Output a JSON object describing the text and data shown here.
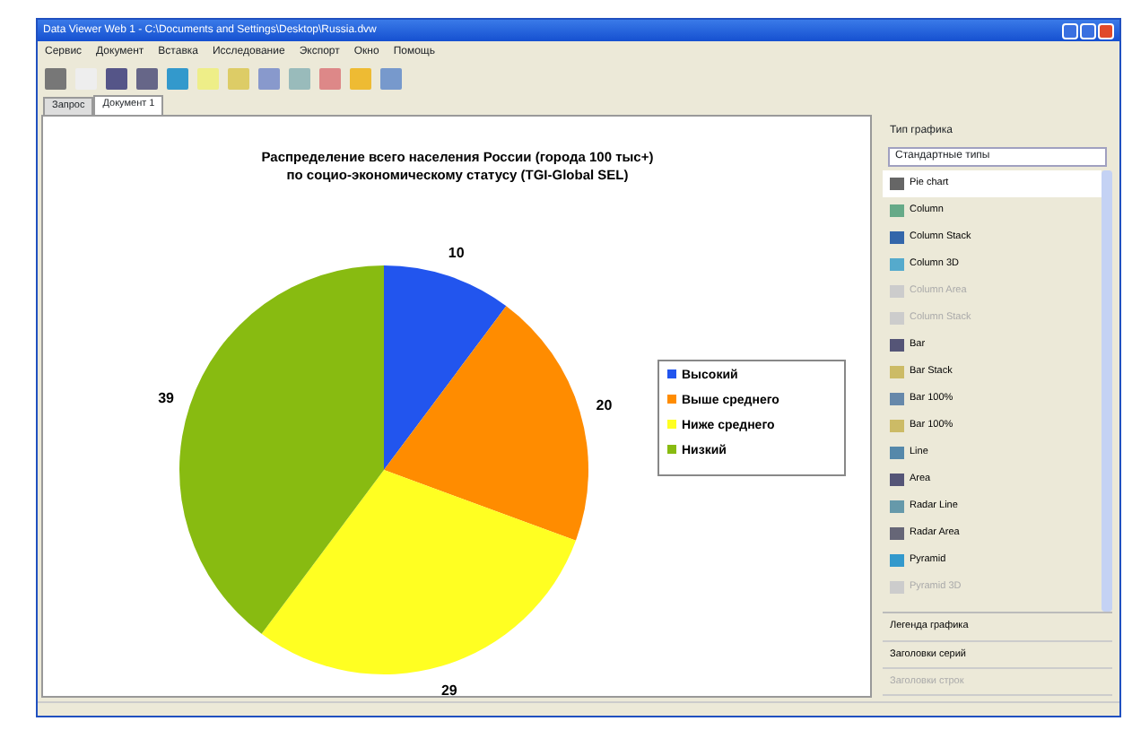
{
  "window": {
    "title": "Data Viewer Web 1 - C:\\Documents and Settings\\Desktop\\Russia.dvw"
  },
  "menu": [
    "Сервис",
    "Документ",
    "Вставка",
    "Исследование",
    "Экспорт",
    "Окно",
    "Помощь"
  ],
  "tabs": [
    {
      "label": "Запрос",
      "selected": false
    },
    {
      "label": "Документ 1",
      "selected": true
    }
  ],
  "chart": {
    "chart_data": {
      "type": "pie",
      "title": "Распределение всего населения России (города 100 тыс+) по социо-экономическому статусу (TGI-Global SEL)",
      "categories": [
        "Высокий",
        "Выше среднего",
        "Ниже среднего",
        "Низкий"
      ],
      "values": [
        10,
        20,
        29,
        39
      ],
      "data_labels": true,
      "legend": "right"
    },
    "slices": [
      {
        "color": "#2255ee"
      },
      {
        "color": "#ff8c00"
      },
      {
        "color": "#ffff22"
      },
      {
        "color": "#88bb11"
      }
    ]
  },
  "sidebar": {
    "title": "Тип графика",
    "dropdown": "Стандартные типы",
    "items": [
      {
        "label": "Pie chart",
        "selected": true,
        "disabled": false
      },
      {
        "label": "Column",
        "selected": false,
        "disabled": false
      },
      {
        "label": "Column Stack",
        "selected": false,
        "disabled": false
      },
      {
        "label": "Column 3D",
        "selected": false,
        "disabled": false
      },
      {
        "label": "Column Area",
        "selected": false,
        "disabled": true
      },
      {
        "label": "Column Stack",
        "selected": false,
        "disabled": true
      },
      {
        "label": "Bar",
        "selected": false,
        "disabled": false
      },
      {
        "label": "Bar Stack",
        "selected": false,
        "disabled": false
      },
      {
        "label": "Bar 100%",
        "selected": false,
        "disabled": false
      },
      {
        "label": "Bar 100%",
        "selected": false,
        "disabled": false
      },
      {
        "label": "Line",
        "selected": false,
        "disabled": false
      },
      {
        "label": "Area",
        "selected": false,
        "disabled": false
      },
      {
        "label": "Radar Line",
        "selected": false,
        "disabled": false
      },
      {
        "label": "Radar Area",
        "selected": false,
        "disabled": false
      },
      {
        "label": "Pyramid",
        "selected": false,
        "disabled": false
      },
      {
        "label": "Pyramid 3D",
        "selected": false,
        "disabled": true
      }
    ],
    "sections": [
      {
        "label": "Легенда графика",
        "disabled": false
      },
      {
        "label": "Заголовки серий",
        "disabled": false
      },
      {
        "label": "Заголовки строк",
        "disabled": true
      }
    ]
  }
}
